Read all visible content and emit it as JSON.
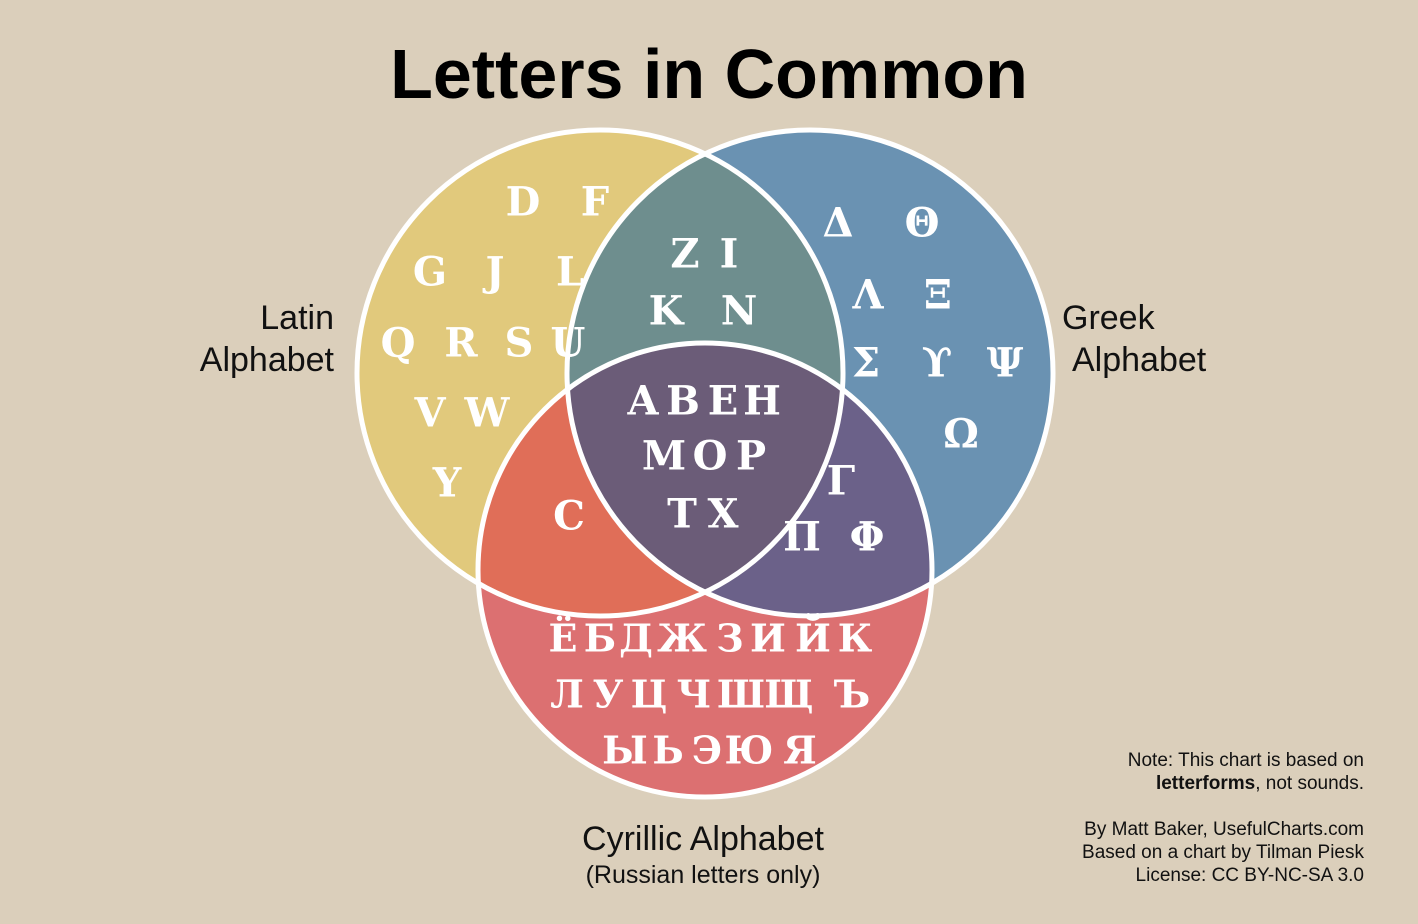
{
  "title": "Letters in Common",
  "sets": {
    "latin": {
      "label_line1": "Latin",
      "label_line2": "Alphabet",
      "color": "#e1c97c"
    },
    "greek": {
      "label_line1": "Greek",
      "label_line2": "Alphabet",
      "color": "#6a92b2"
    },
    "cyrillic": {
      "label": "Cyrillic Alphabet",
      "sublabel": "(Russian letters only)",
      "color": "#dc7071"
    }
  },
  "regions": {
    "latin_only": {
      "color": "#e1c97c",
      "letters": [
        "D",
        "F",
        "G",
        "J",
        "L",
        "Q",
        "R",
        "S",
        "U",
        "V",
        "W",
        "Y"
      ]
    },
    "greek_only": {
      "color": "#6a92b2",
      "letters": [
        "Δ",
        "Θ",
        "Λ",
        "Ξ",
        "Σ",
        "ϒ",
        "Ψ",
        "Ω"
      ]
    },
    "latin_greek": {
      "color": "#6e8e8e",
      "letters": [
        "Z",
        "I",
        "K",
        "N"
      ]
    },
    "latin_cyrillic": {
      "color": "#e06e58",
      "letters": [
        "C"
      ]
    },
    "greek_cyrillic": {
      "color": "#6b6189",
      "letters": [
        "Γ",
        "Π",
        "Φ"
      ]
    },
    "all_three": {
      "color": "#6b5c78",
      "letters": [
        "A",
        "B",
        "E",
        "H",
        "M",
        "O",
        "P",
        "T",
        "X"
      ]
    },
    "cyrillic_only": {
      "color": "#dc7071",
      "letters": [
        "Ё",
        "Б",
        "Д",
        "Ж",
        "З",
        "И",
        "Й",
        "К",
        "Л",
        "У",
        "Ц",
        "Ч",
        "Ш",
        "Щ",
        "Ъ",
        "Ы",
        "Ь",
        "Э",
        "Ю",
        "Я"
      ]
    }
  },
  "notes": {
    "line1": "Note: This chart is based on",
    "line2_bold": "letterforms",
    "line2_rest": ", not sounds.",
    "credit1": "By Matt Baker, UsefulCharts.com",
    "credit2": "Based on a chart by Tilman Piesk",
    "credit3": "License: CC BY-NC-SA 3.0"
  }
}
